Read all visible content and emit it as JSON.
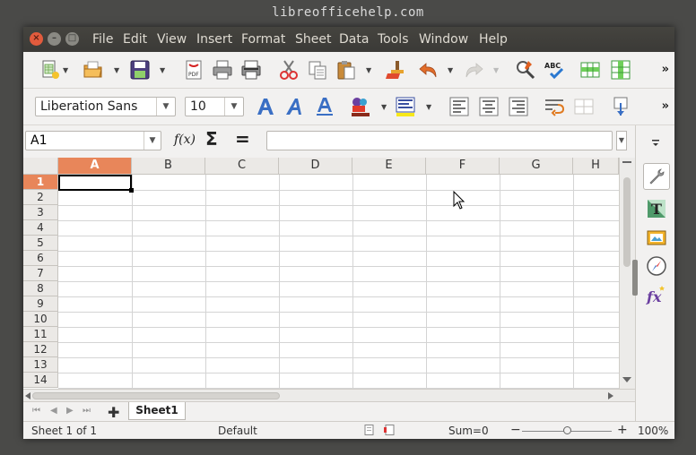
{
  "desktop": {
    "title": "libreofficehelp.com"
  },
  "menu": [
    "File",
    "Edit",
    "View",
    "Insert",
    "Format",
    "Sheet",
    "Data",
    "Tools",
    "Window",
    "Help"
  ],
  "toolbar": {
    "more": "»",
    "font_name": "Liberation Sans",
    "font_size": "10",
    "pdf_label": "PDF",
    "abc_label": "ABC"
  },
  "formula_bar": {
    "cell_ref": "A1",
    "fx": "f(x)",
    "sigma": "Σ",
    "equals": "=",
    "value": ""
  },
  "grid": {
    "columns": [
      "A",
      "B",
      "C",
      "D",
      "E",
      "F",
      "G",
      "H"
    ],
    "rows": [
      "1",
      "2",
      "3",
      "4",
      "5",
      "6",
      "7",
      "8",
      "9",
      "10",
      "11",
      "12",
      "13",
      "14"
    ],
    "selected_column": "A",
    "selected_row": "1"
  },
  "sheets": {
    "tabs": [
      "Sheet1"
    ],
    "add": "✚"
  },
  "status": {
    "sheet": "Sheet 1 of 1",
    "style": "Default",
    "sum": "Sum=0",
    "zoom": "100%",
    "zoom_minus": "−",
    "zoom_plus": "+"
  }
}
